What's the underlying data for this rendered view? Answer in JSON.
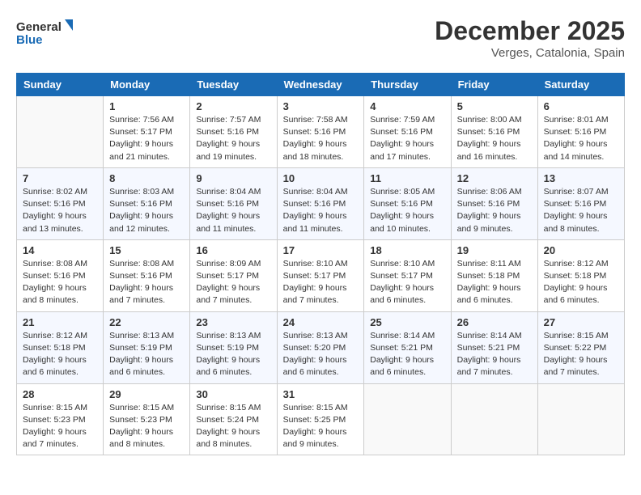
{
  "header": {
    "logo_line1": "General",
    "logo_line2": "Blue",
    "main_title": "December 2025",
    "subtitle": "Verges, Catalonia, Spain"
  },
  "days_of_week": [
    "Sunday",
    "Monday",
    "Tuesday",
    "Wednesday",
    "Thursday",
    "Friday",
    "Saturday"
  ],
  "weeks": [
    [
      {
        "day": "",
        "info": ""
      },
      {
        "day": "1",
        "info": "Sunrise: 7:56 AM\nSunset: 5:17 PM\nDaylight: 9 hours\nand 21 minutes."
      },
      {
        "day": "2",
        "info": "Sunrise: 7:57 AM\nSunset: 5:16 PM\nDaylight: 9 hours\nand 19 minutes."
      },
      {
        "day": "3",
        "info": "Sunrise: 7:58 AM\nSunset: 5:16 PM\nDaylight: 9 hours\nand 18 minutes."
      },
      {
        "day": "4",
        "info": "Sunrise: 7:59 AM\nSunset: 5:16 PM\nDaylight: 9 hours\nand 17 minutes."
      },
      {
        "day": "5",
        "info": "Sunrise: 8:00 AM\nSunset: 5:16 PM\nDaylight: 9 hours\nand 16 minutes."
      },
      {
        "day": "6",
        "info": "Sunrise: 8:01 AM\nSunset: 5:16 PM\nDaylight: 9 hours\nand 14 minutes."
      }
    ],
    [
      {
        "day": "7",
        "info": "Sunrise: 8:02 AM\nSunset: 5:16 PM\nDaylight: 9 hours\nand 13 minutes."
      },
      {
        "day": "8",
        "info": "Sunrise: 8:03 AM\nSunset: 5:16 PM\nDaylight: 9 hours\nand 12 minutes."
      },
      {
        "day": "9",
        "info": "Sunrise: 8:04 AM\nSunset: 5:16 PM\nDaylight: 9 hours\nand 11 minutes."
      },
      {
        "day": "10",
        "info": "Sunrise: 8:04 AM\nSunset: 5:16 PM\nDaylight: 9 hours\nand 11 minutes."
      },
      {
        "day": "11",
        "info": "Sunrise: 8:05 AM\nSunset: 5:16 PM\nDaylight: 9 hours\nand 10 minutes."
      },
      {
        "day": "12",
        "info": "Sunrise: 8:06 AM\nSunset: 5:16 PM\nDaylight: 9 hours\nand 9 minutes."
      },
      {
        "day": "13",
        "info": "Sunrise: 8:07 AM\nSunset: 5:16 PM\nDaylight: 9 hours\nand 8 minutes."
      }
    ],
    [
      {
        "day": "14",
        "info": "Sunrise: 8:08 AM\nSunset: 5:16 PM\nDaylight: 9 hours\nand 8 minutes."
      },
      {
        "day": "15",
        "info": "Sunrise: 8:08 AM\nSunset: 5:16 PM\nDaylight: 9 hours\nand 7 minutes."
      },
      {
        "day": "16",
        "info": "Sunrise: 8:09 AM\nSunset: 5:17 PM\nDaylight: 9 hours\nand 7 minutes."
      },
      {
        "day": "17",
        "info": "Sunrise: 8:10 AM\nSunset: 5:17 PM\nDaylight: 9 hours\nand 7 minutes."
      },
      {
        "day": "18",
        "info": "Sunrise: 8:10 AM\nSunset: 5:17 PM\nDaylight: 9 hours\nand 6 minutes."
      },
      {
        "day": "19",
        "info": "Sunrise: 8:11 AM\nSunset: 5:18 PM\nDaylight: 9 hours\nand 6 minutes."
      },
      {
        "day": "20",
        "info": "Sunrise: 8:12 AM\nSunset: 5:18 PM\nDaylight: 9 hours\nand 6 minutes."
      }
    ],
    [
      {
        "day": "21",
        "info": "Sunrise: 8:12 AM\nSunset: 5:18 PM\nDaylight: 9 hours\nand 6 minutes."
      },
      {
        "day": "22",
        "info": "Sunrise: 8:13 AM\nSunset: 5:19 PM\nDaylight: 9 hours\nand 6 minutes."
      },
      {
        "day": "23",
        "info": "Sunrise: 8:13 AM\nSunset: 5:19 PM\nDaylight: 9 hours\nand 6 minutes."
      },
      {
        "day": "24",
        "info": "Sunrise: 8:13 AM\nSunset: 5:20 PM\nDaylight: 9 hours\nand 6 minutes."
      },
      {
        "day": "25",
        "info": "Sunrise: 8:14 AM\nSunset: 5:21 PM\nDaylight: 9 hours\nand 6 minutes."
      },
      {
        "day": "26",
        "info": "Sunrise: 8:14 AM\nSunset: 5:21 PM\nDaylight: 9 hours\nand 7 minutes."
      },
      {
        "day": "27",
        "info": "Sunrise: 8:15 AM\nSunset: 5:22 PM\nDaylight: 9 hours\nand 7 minutes."
      }
    ],
    [
      {
        "day": "28",
        "info": "Sunrise: 8:15 AM\nSunset: 5:23 PM\nDaylight: 9 hours\nand 7 minutes."
      },
      {
        "day": "29",
        "info": "Sunrise: 8:15 AM\nSunset: 5:23 PM\nDaylight: 9 hours\nand 8 minutes."
      },
      {
        "day": "30",
        "info": "Sunrise: 8:15 AM\nSunset: 5:24 PM\nDaylight: 9 hours\nand 8 minutes."
      },
      {
        "day": "31",
        "info": "Sunrise: 8:15 AM\nSunset: 5:25 PM\nDaylight: 9 hours\nand 9 minutes."
      },
      {
        "day": "",
        "info": ""
      },
      {
        "day": "",
        "info": ""
      },
      {
        "day": "",
        "info": ""
      }
    ]
  ]
}
